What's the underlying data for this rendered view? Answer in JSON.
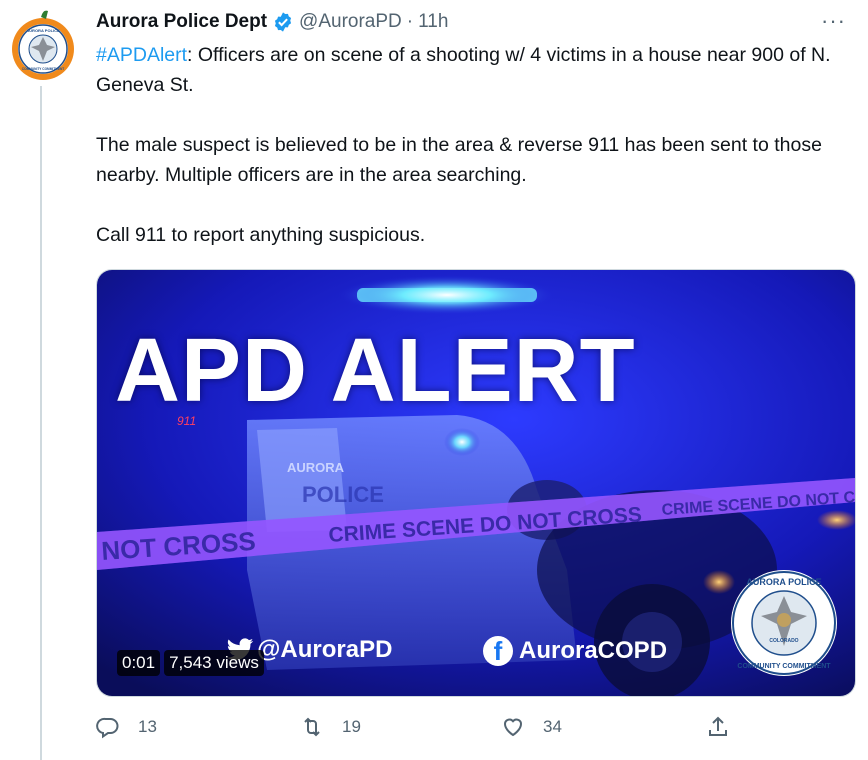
{
  "tweet": {
    "author_name": "Aurora Police Dept",
    "handle": "@AuroraPD",
    "separator": "·",
    "time": "11h",
    "more_label": "···",
    "hashtag": "#APDAlert",
    "line1_rest": ": Officers are on scene of a shooting w/ 4 victims in a house near 900 of N. Geneva St.",
    "paragraph2": "The male suspect is believed to be in the area & reverse 911 has been sent to those nearby. Multiple officers are in the area searching.",
    "paragraph3": "Call 911 to report anything suspicious."
  },
  "avatar": {
    "top_text": "AURORA POLICE",
    "bottom_text": "COMMUNITY COMMITMENT"
  },
  "media": {
    "title": "APD ALERT",
    "car_text": "AURORA",
    "car_text2": "POLICE",
    "car_number": "911",
    "tape_text_left": "NOT CROSS",
    "tape_text_mid": "CRIME SCENE DO NOT CROSS",
    "tape_text_right": "CRIME SCENE DO NOT CROS",
    "twitter_handle": "@AuroraPD",
    "facebook_handle": "AuroraCOPD",
    "facebook_glyph": "f",
    "time_badge": "0:01",
    "views_badge": "7,543 views",
    "seal_top": "AURORA POLICE",
    "seal_bottom": "COMMUNITY COMMITMENT",
    "seal_center": "COLORADO"
  },
  "actions": {
    "reply_count": "13",
    "retweet_count": "19",
    "like_count": "34"
  },
  "colors": {
    "link": "#1d9bf0",
    "muted": "#536471",
    "verified": "#1d9bf0",
    "media_bg": "#1a1fd8"
  }
}
